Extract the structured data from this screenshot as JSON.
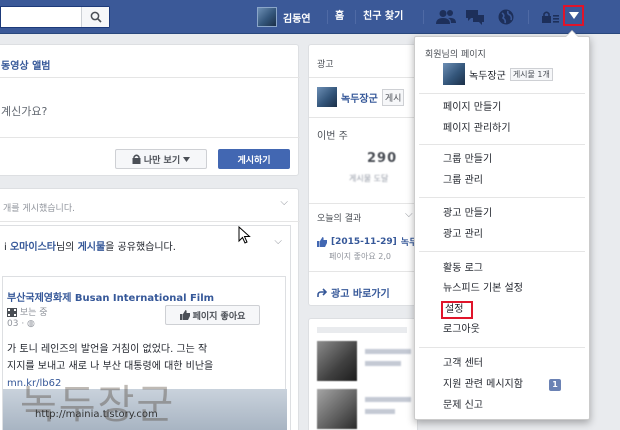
{
  "topbar": {
    "profile_name": "김동연",
    "home_label": "홈",
    "find_friends_label": "친구 찾기",
    "colors": {
      "bar": "#3b5998",
      "highlight": "#e0142a"
    }
  },
  "composer": {
    "tab_label": "동영상 앨범",
    "prompt": "계신가요?",
    "privacy_label": "나만 보기",
    "post_button": "게시하기"
  },
  "feed": {
    "note": "개를 게시했습니다.",
    "share": {
      "person": "오마이스타",
      "mid": "님의",
      "object": "게시물",
      "suffix": "을 공유했습니다."
    },
    "page_name": "부산국제영화제 Busan International Film",
    "page_meta": "보는 중",
    "page_time": "03 · ",
    "like_page_button": "페이지 좋아요",
    "text_line1": "가 토니 레인즈의 발언을 거침이 없었다. 그는 작",
    "text_line2": "지지를 보내고 새로 나 부산 대통령에 대한 비난을",
    "text_line3": "mn.kr/lb62"
  },
  "ad": {
    "label": "광고",
    "page_name": "녹두장군",
    "post_button": "게시",
    "week_label": "이번 주",
    "week_count": "290",
    "week_sub": "게시물 도달",
    "result_label": "오늘의 결과",
    "result_date": "[2015-11-29]",
    "result_page": "녹두",
    "result_sub": "페이지 좋아요 2,0",
    "shortcut": "광고 바로가기"
  },
  "menu": {
    "heading": "회원님의 페이지",
    "page_name": "녹두장군",
    "page_badge": "게시물 1개",
    "items": {
      "create_page": "페이지 만들기",
      "manage_pages": "페이지 관리하기",
      "create_group": "그룹 만들기",
      "manage_groups": "그룹 관리",
      "create_ad": "광고 만들기",
      "manage_ads": "광고 관리",
      "activity_log": "활동 로그",
      "newsfeed_prefs": "뉴스피드 기본 설정",
      "settings": "설정",
      "logout": "로그아웃",
      "help_center": "고객 센터",
      "support_inbox": "지원 관련 메시지함",
      "report_problem": "문제 신고"
    },
    "support_badge": "1"
  },
  "watermark": {
    "text": "녹두장군",
    "url": "http://mainia.tistory.com"
  }
}
